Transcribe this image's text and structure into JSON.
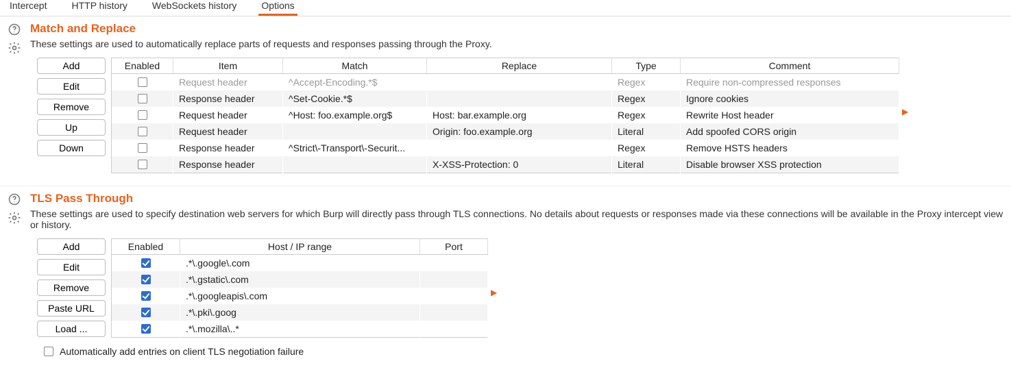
{
  "tabs": {
    "items": [
      "Intercept",
      "HTTP history",
      "WebSockets history",
      "Options"
    ],
    "active_index": 3
  },
  "match_replace": {
    "title": "Match and Replace",
    "desc": "These settings are used to automatically replace parts of requests and responses passing through the Proxy.",
    "buttons": [
      "Add",
      "Edit",
      "Remove",
      "Up",
      "Down"
    ],
    "columns": [
      "Enabled",
      "Item",
      "Match",
      "Replace",
      "Type",
      "Comment"
    ],
    "rows": [
      {
        "enabled": false,
        "item": "Request header",
        "match": "^Accept-Encoding.*$",
        "replace": "",
        "type": "Regex",
        "comment": "Require non-compressed responses",
        "cut": true
      },
      {
        "enabled": false,
        "item": "Response header",
        "match": "^Set-Cookie.*$",
        "replace": "",
        "type": "Regex",
        "comment": "Ignore cookies"
      },
      {
        "enabled": false,
        "item": "Request header",
        "match": "^Host: foo.example.org$",
        "replace": "Host: bar.example.org",
        "type": "Regex",
        "comment": "Rewrite Host header"
      },
      {
        "enabled": false,
        "item": "Request header",
        "match": "",
        "replace": "Origin: foo.example.org",
        "type": "Literal",
        "comment": "Add spoofed CORS origin"
      },
      {
        "enabled": false,
        "item": "Response header",
        "match": "^Strict\\-Transport\\-Securit...",
        "replace": "",
        "type": "Regex",
        "comment": "Remove HSTS headers"
      },
      {
        "enabled": false,
        "item": "Response header",
        "match": "",
        "replace": "X-XSS-Protection: 0",
        "type": "Literal",
        "comment": "Disable browser XSS protection"
      }
    ]
  },
  "tls_passthrough": {
    "title": "TLS Pass Through",
    "desc": "These settings are used to specify destination web servers for which Burp will directly pass through TLS connections. No details about requests or responses made via these connections will be available in the Proxy intercept view or history.",
    "buttons": [
      "Add",
      "Edit",
      "Remove",
      "Paste URL",
      "Load ..."
    ],
    "columns": [
      "Enabled",
      "Host / IP range",
      "Port"
    ],
    "rows": [
      {
        "enabled": true,
        "host": ".*\\.google\\.com",
        "port": ""
      },
      {
        "enabled": true,
        "host": ".*\\.gstatic\\.com",
        "port": ""
      },
      {
        "enabled": true,
        "host": ".*\\.googleapis\\.com",
        "port": ""
      },
      {
        "enabled": true,
        "host": ".*\\.pki\\.goog",
        "port": ""
      },
      {
        "enabled": true,
        "host": ".*\\.mozilla\\..*",
        "port": ""
      }
    ],
    "auto_add": {
      "checked": false,
      "label": "Automatically add entries on client TLS negotiation failure"
    }
  }
}
